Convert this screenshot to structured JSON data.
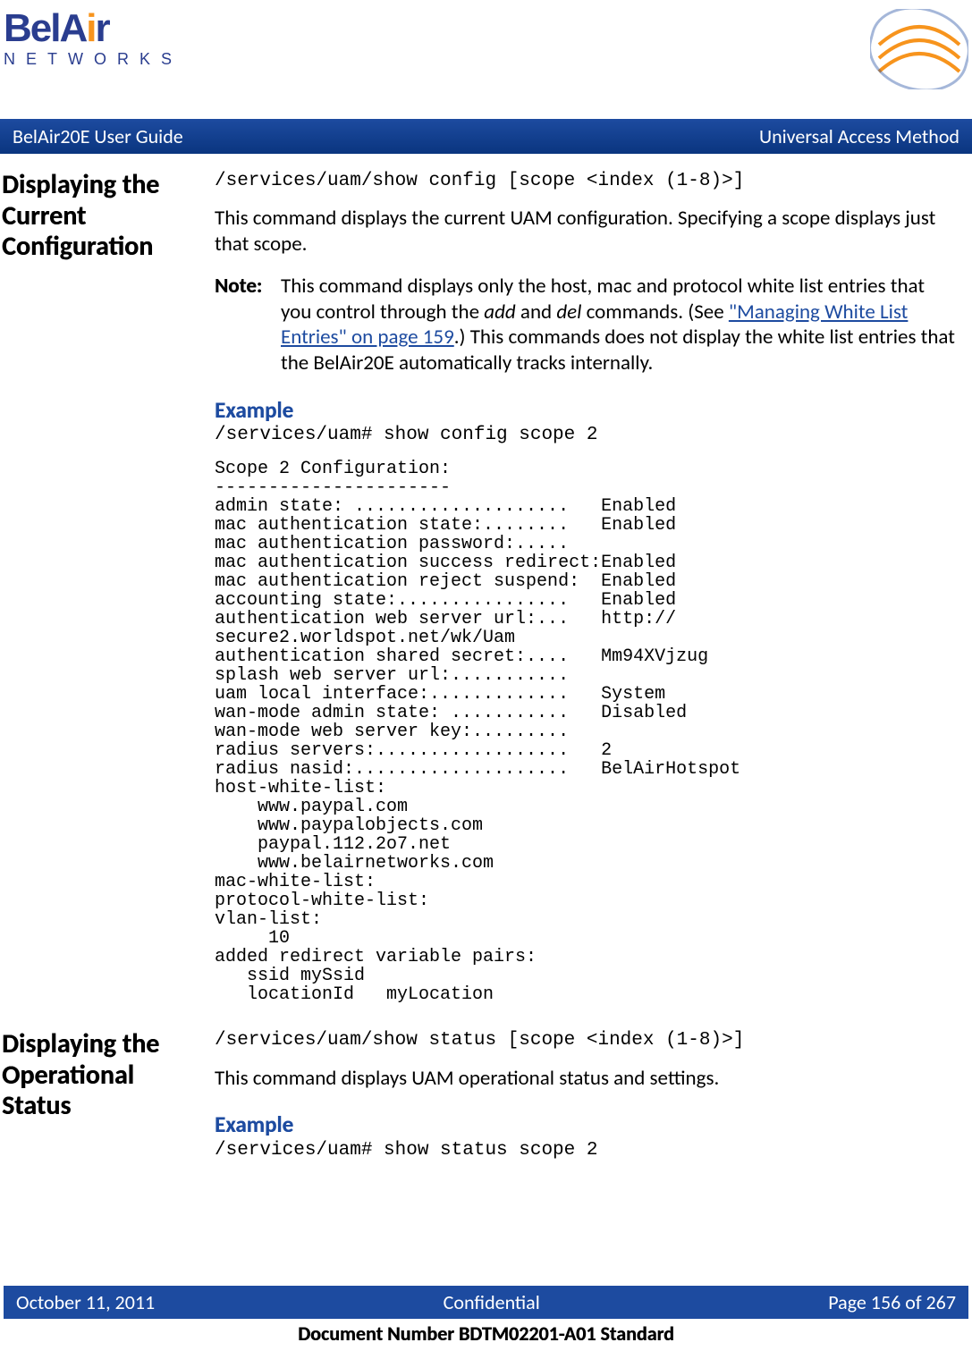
{
  "header": {
    "logo_main_html": "BelA<span class=\"a-letter\">i</span>r",
    "logo_sub": "NETWORKS"
  },
  "title_bar": {
    "left": "BelAir20E User Guide",
    "right": "Universal Access Method"
  },
  "section1": {
    "heading": "Displaying the Current Configuration",
    "command": "/services/uam/show config [scope <index (1-8)>]",
    "desc": "This command displays the current UAM configuration. Specifying a scope displays just that scope.",
    "note_label": "Note:",
    "note_pre": "This command displays only the host, mac and protocol white list entries that you control through the ",
    "note_add": "add",
    "note_and": " and ",
    "note_del": "del",
    "note_mid1": " commands. (See ",
    "note_link": "\"Managing White List Entries\" on page 159",
    "note_mid2": ".) This commands does not display the white list entries that the BelAir20E automatically tracks internally.",
    "example_label": "Example",
    "example_cmd": "/services/uam# show config scope 2",
    "example_output": "Scope 2 Configuration:\n----------------------\nadmin state: ....................   Enabled\nmac authentication state:........   Enabled\nmac authentication password:.....\nmac authentication success redirect:Enabled\nmac authentication reject suspend:  Enabled\naccounting state:................   Enabled\nauthentication web server url:...   http://\nsecure2.worldspot.net/wk/Uam\nauthentication shared secret:....   Mm94XVjzug\nsplash web server url:...........\nuam local interface:.............   System\nwan-mode admin state: ...........   Disabled\nwan-mode web server key:.........\nradius servers:..................   2\nradius nasid:....................   BelAirHotspot\nhost-white-list:\n    www.paypal.com\n    www.paypalobjects.com\n    paypal.112.2o7.net\n    www.belairnetworks.com\nmac-white-list:\nprotocol-white-list:\nvlan-list:\n     10\nadded redirect variable pairs:\n   ssid mySsid\n   locationId   myLocation"
  },
  "section2": {
    "heading": "Displaying the Operational Status",
    "command": "/services/uam/show status [scope <index (1-8)>]",
    "desc": "This command displays UAM operational status and settings.",
    "example_label": "Example",
    "example_cmd": "/services/uam# show status scope 2"
  },
  "footer": {
    "date": "October 11, 2011",
    "confidential": "Confidential",
    "page": "Page 156 of 267",
    "docnum": "Document Number BDTM02201-A01 Standard"
  }
}
